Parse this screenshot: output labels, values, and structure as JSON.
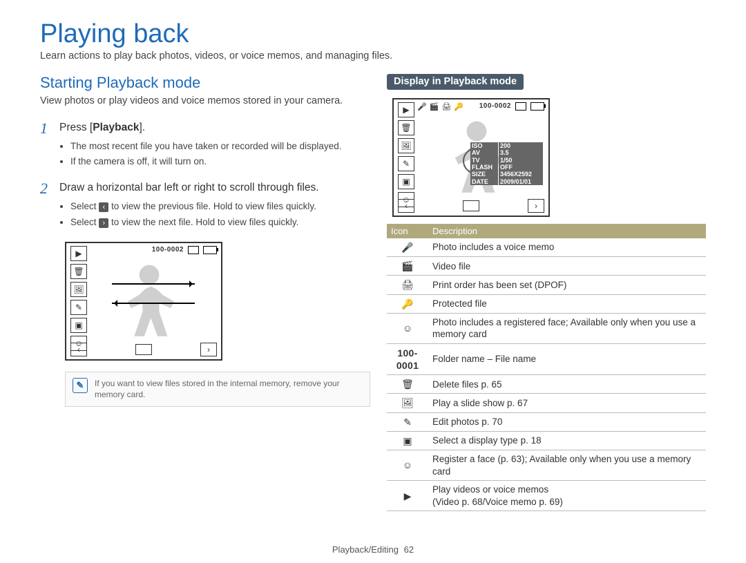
{
  "title": "Playing back",
  "intro": "Learn actions to play back photos, videos, or voice memos, and managing files.",
  "section_title": "Starting Playback mode",
  "section_lead": "View photos or play videos and voice memos stored in your camera.",
  "steps": [
    {
      "num": "1",
      "text_pre": "Press [",
      "text_bold": "Playback",
      "text_post": "].",
      "bullets": [
        "The most recent file you have taken or recorded will be displayed.",
        "If the camera is off, it will turn on."
      ]
    },
    {
      "num": "2",
      "text_plain": "Draw a horizontal bar left or right to scroll through files.",
      "bullets": [
        {
          "pre": "Select ",
          "chev": "‹",
          "post": " to view the previous file. Hold to view files quickly."
        },
        {
          "pre": "Select ",
          "chev": "›",
          "post": " to view the next file. Hold to view files quickly."
        }
      ]
    }
  ],
  "screenshot_left": {
    "file_number": "100-0002",
    "left_icons": [
      "▶",
      "🗑",
      "🖼",
      "✎",
      "▣",
      "☺"
    ]
  },
  "note": {
    "icon": "✎",
    "text": "If you want to view files stored in the internal memory, remove your memory card."
  },
  "right_pill": "Display in Playback mode",
  "screenshot_right": {
    "file_number": "100-0002",
    "top_icons": [
      "🎤",
      "🎬",
      "🖨",
      "🔑"
    ],
    "left_icons": [
      "▶",
      "🗑",
      "🖼",
      "✎",
      "▣",
      "☺"
    ],
    "info": [
      {
        "label": "ISO",
        "value": "200"
      },
      {
        "label": "AV",
        "value": "3.5"
      },
      {
        "label": "TV",
        "value": "1/50"
      },
      {
        "label": "FLASH",
        "value": "OFF"
      },
      {
        "label": "SIZE",
        "value": "3456X2592"
      },
      {
        "label": "DATE",
        "value": "2009/01/01"
      }
    ]
  },
  "table": {
    "headers": [
      "Icon",
      "Description"
    ],
    "rows": [
      {
        "icon": "🎤",
        "desc": "Photo includes a voice memo"
      },
      {
        "icon": "🎬",
        "desc": "Video file"
      },
      {
        "icon": "🖨",
        "desc": "Print order has been set (DPOF)"
      },
      {
        "icon": "🔑",
        "desc": "Protected file"
      },
      {
        "icon": "☺",
        "desc": "Photo includes a registered face; Available only when you use a memory card"
      },
      {
        "icon_text": "100-0001",
        "desc": "Folder name – File name"
      },
      {
        "icon": "🗑",
        "desc": "Delete files p. 65"
      },
      {
        "icon": "🖼",
        "desc": "Play a slide show p. 67"
      },
      {
        "icon": "✎",
        "desc": "Edit photos p. 70"
      },
      {
        "icon": "▣",
        "desc": "Select a display type p. 18"
      },
      {
        "icon": "☺",
        "desc": "Register a face (p. 63); Available only when you use a memory card"
      },
      {
        "icon": "▶",
        "desc": "Play videos or voice memos\n(Video p. 68/Voice memo p. 69)"
      }
    ]
  },
  "footer": {
    "section": "Playback/Editing",
    "page": "62"
  }
}
